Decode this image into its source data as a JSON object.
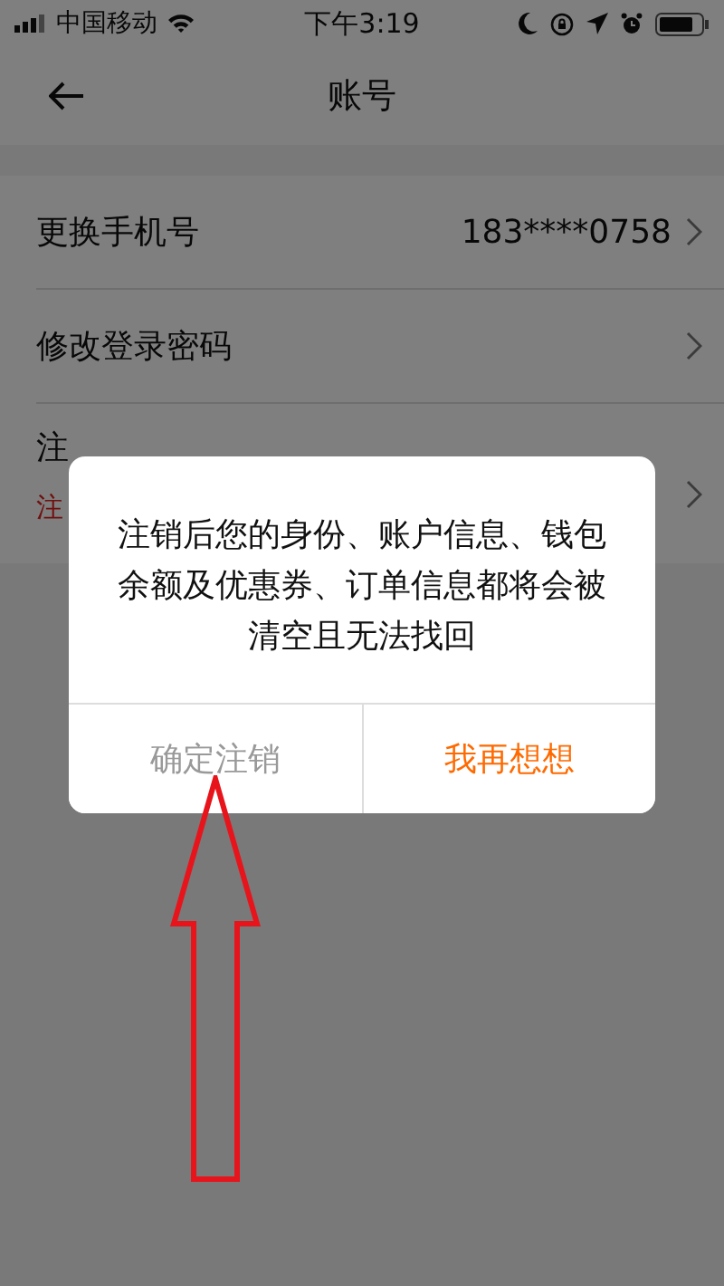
{
  "status_bar": {
    "carrier": "中国移动",
    "time": "下午3:19"
  },
  "nav": {
    "title": "账号"
  },
  "settings": [
    {
      "label": "更换手机号",
      "value": "183****0758"
    },
    {
      "label": "修改登录密码"
    },
    {
      "label": "注",
      "note": "注"
    }
  ],
  "dialog": {
    "message": "注销后您的身份、账户信息、钱包余额及优惠券、订单信息都将会被清空且无法找回",
    "buttons": [
      {
        "label": "确定注销",
        "kind": "secondary"
      },
      {
        "label": "我再想想",
        "kind": "primary"
      }
    ]
  }
}
